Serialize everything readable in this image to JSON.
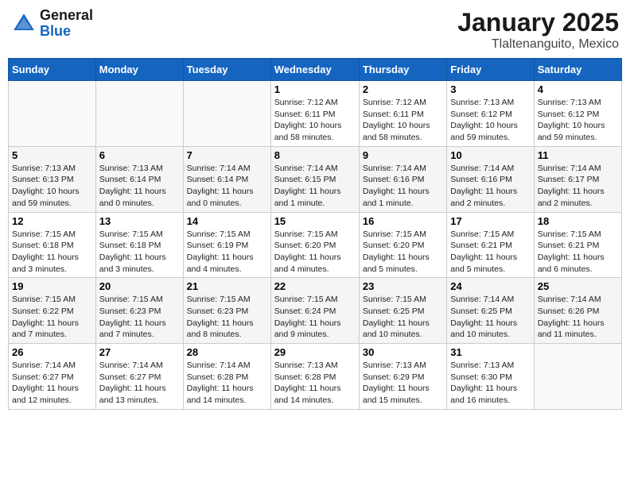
{
  "header": {
    "logo_general": "General",
    "logo_blue": "Blue",
    "title": "January 2025",
    "subtitle": "Tlaltenanguito, Mexico"
  },
  "weekdays": [
    "Sunday",
    "Monday",
    "Tuesday",
    "Wednesday",
    "Thursday",
    "Friday",
    "Saturday"
  ],
  "weeks": [
    [
      {
        "day": "",
        "info": ""
      },
      {
        "day": "",
        "info": ""
      },
      {
        "day": "",
        "info": ""
      },
      {
        "day": "1",
        "info": "Sunrise: 7:12 AM\nSunset: 6:11 PM\nDaylight: 10 hours\nand 58 minutes."
      },
      {
        "day": "2",
        "info": "Sunrise: 7:12 AM\nSunset: 6:11 PM\nDaylight: 10 hours\nand 58 minutes."
      },
      {
        "day": "3",
        "info": "Sunrise: 7:13 AM\nSunset: 6:12 PM\nDaylight: 10 hours\nand 59 minutes."
      },
      {
        "day": "4",
        "info": "Sunrise: 7:13 AM\nSunset: 6:12 PM\nDaylight: 10 hours\nand 59 minutes."
      }
    ],
    [
      {
        "day": "5",
        "info": "Sunrise: 7:13 AM\nSunset: 6:13 PM\nDaylight: 10 hours\nand 59 minutes."
      },
      {
        "day": "6",
        "info": "Sunrise: 7:13 AM\nSunset: 6:14 PM\nDaylight: 11 hours\nand 0 minutes."
      },
      {
        "day": "7",
        "info": "Sunrise: 7:14 AM\nSunset: 6:14 PM\nDaylight: 11 hours\nand 0 minutes."
      },
      {
        "day": "8",
        "info": "Sunrise: 7:14 AM\nSunset: 6:15 PM\nDaylight: 11 hours\nand 1 minute."
      },
      {
        "day": "9",
        "info": "Sunrise: 7:14 AM\nSunset: 6:16 PM\nDaylight: 11 hours\nand 1 minute."
      },
      {
        "day": "10",
        "info": "Sunrise: 7:14 AM\nSunset: 6:16 PM\nDaylight: 11 hours\nand 2 minutes."
      },
      {
        "day": "11",
        "info": "Sunrise: 7:14 AM\nSunset: 6:17 PM\nDaylight: 11 hours\nand 2 minutes."
      }
    ],
    [
      {
        "day": "12",
        "info": "Sunrise: 7:15 AM\nSunset: 6:18 PM\nDaylight: 11 hours\nand 3 minutes."
      },
      {
        "day": "13",
        "info": "Sunrise: 7:15 AM\nSunset: 6:18 PM\nDaylight: 11 hours\nand 3 minutes."
      },
      {
        "day": "14",
        "info": "Sunrise: 7:15 AM\nSunset: 6:19 PM\nDaylight: 11 hours\nand 4 minutes."
      },
      {
        "day": "15",
        "info": "Sunrise: 7:15 AM\nSunset: 6:20 PM\nDaylight: 11 hours\nand 4 minutes."
      },
      {
        "day": "16",
        "info": "Sunrise: 7:15 AM\nSunset: 6:20 PM\nDaylight: 11 hours\nand 5 minutes."
      },
      {
        "day": "17",
        "info": "Sunrise: 7:15 AM\nSunset: 6:21 PM\nDaylight: 11 hours\nand 5 minutes."
      },
      {
        "day": "18",
        "info": "Sunrise: 7:15 AM\nSunset: 6:21 PM\nDaylight: 11 hours\nand 6 minutes."
      }
    ],
    [
      {
        "day": "19",
        "info": "Sunrise: 7:15 AM\nSunset: 6:22 PM\nDaylight: 11 hours\nand 7 minutes."
      },
      {
        "day": "20",
        "info": "Sunrise: 7:15 AM\nSunset: 6:23 PM\nDaylight: 11 hours\nand 7 minutes."
      },
      {
        "day": "21",
        "info": "Sunrise: 7:15 AM\nSunset: 6:23 PM\nDaylight: 11 hours\nand 8 minutes."
      },
      {
        "day": "22",
        "info": "Sunrise: 7:15 AM\nSunset: 6:24 PM\nDaylight: 11 hours\nand 9 minutes."
      },
      {
        "day": "23",
        "info": "Sunrise: 7:15 AM\nSunset: 6:25 PM\nDaylight: 11 hours\nand 10 minutes."
      },
      {
        "day": "24",
        "info": "Sunrise: 7:14 AM\nSunset: 6:25 PM\nDaylight: 11 hours\nand 10 minutes."
      },
      {
        "day": "25",
        "info": "Sunrise: 7:14 AM\nSunset: 6:26 PM\nDaylight: 11 hours\nand 11 minutes."
      }
    ],
    [
      {
        "day": "26",
        "info": "Sunrise: 7:14 AM\nSunset: 6:27 PM\nDaylight: 11 hours\nand 12 minutes."
      },
      {
        "day": "27",
        "info": "Sunrise: 7:14 AM\nSunset: 6:27 PM\nDaylight: 11 hours\nand 13 minutes."
      },
      {
        "day": "28",
        "info": "Sunrise: 7:14 AM\nSunset: 6:28 PM\nDaylight: 11 hours\nand 14 minutes."
      },
      {
        "day": "29",
        "info": "Sunrise: 7:13 AM\nSunset: 6:28 PM\nDaylight: 11 hours\nand 14 minutes."
      },
      {
        "day": "30",
        "info": "Sunrise: 7:13 AM\nSunset: 6:29 PM\nDaylight: 11 hours\nand 15 minutes."
      },
      {
        "day": "31",
        "info": "Sunrise: 7:13 AM\nSunset: 6:30 PM\nDaylight: 11 hours\nand 16 minutes."
      },
      {
        "day": "",
        "info": ""
      }
    ]
  ]
}
